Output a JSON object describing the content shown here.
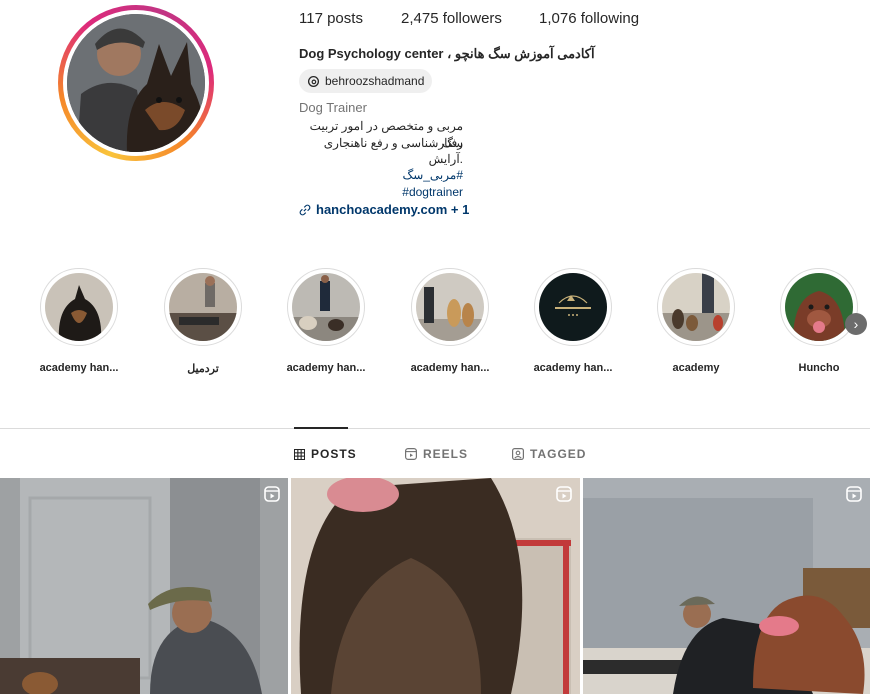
{
  "profile": {
    "stats": {
      "posts_count": "117",
      "posts_label": "posts",
      "followers_count": "2,475",
      "followers_label": "followers",
      "following_count": "1,076",
      "following_label": "following"
    },
    "name": "Dog Psychology center",
    "name_fa": "آکادمی آموزش سگ هانچو ،",
    "threads_handle": "behroozshadmand",
    "category": "Dog Trainer",
    "bio_lines": [
      "مربی و متخصص در امور تربیت سگ",
      "رفتارشناسی و رفع ناهنجاری",
      ".آرایش"
    ],
    "hashtags": [
      "#مربی_سگ",
      "dogtrainer#"
    ],
    "website": "hanchoacademy.com + 1"
  },
  "highlights": [
    {
      "label": "academy han...",
      "icon": "dog-photo"
    },
    {
      "label": "تردمیل",
      "icon": "treadmill-photo"
    },
    {
      "label": "academy han...",
      "icon": "dogs-group-photo"
    },
    {
      "label": "academy han...",
      "icon": "dogs-indoor-photo"
    },
    {
      "label": "academy han...",
      "icon": "academy-logo"
    },
    {
      "label": "academy",
      "icon": "dogs-outdoor-photo"
    },
    {
      "label": "Huncho",
      "icon": "pitbull-photo"
    }
  ],
  "tabs": [
    {
      "label": "POSTS",
      "icon": "grid-icon",
      "active": true
    },
    {
      "label": "REELS",
      "icon": "reels-icon",
      "active": false
    },
    {
      "label": "TAGGED",
      "icon": "tagged-icon",
      "active": false
    }
  ],
  "posts": [
    {
      "type": "reel",
      "icon": "reels-icon"
    },
    {
      "type": "reel",
      "icon": "reels-icon"
    },
    {
      "type": "reel",
      "icon": "reels-icon"
    }
  ],
  "colors": {
    "link": "#00376b",
    "text": "#262626",
    "muted": "#737373",
    "border": "#dbdbdb"
  }
}
